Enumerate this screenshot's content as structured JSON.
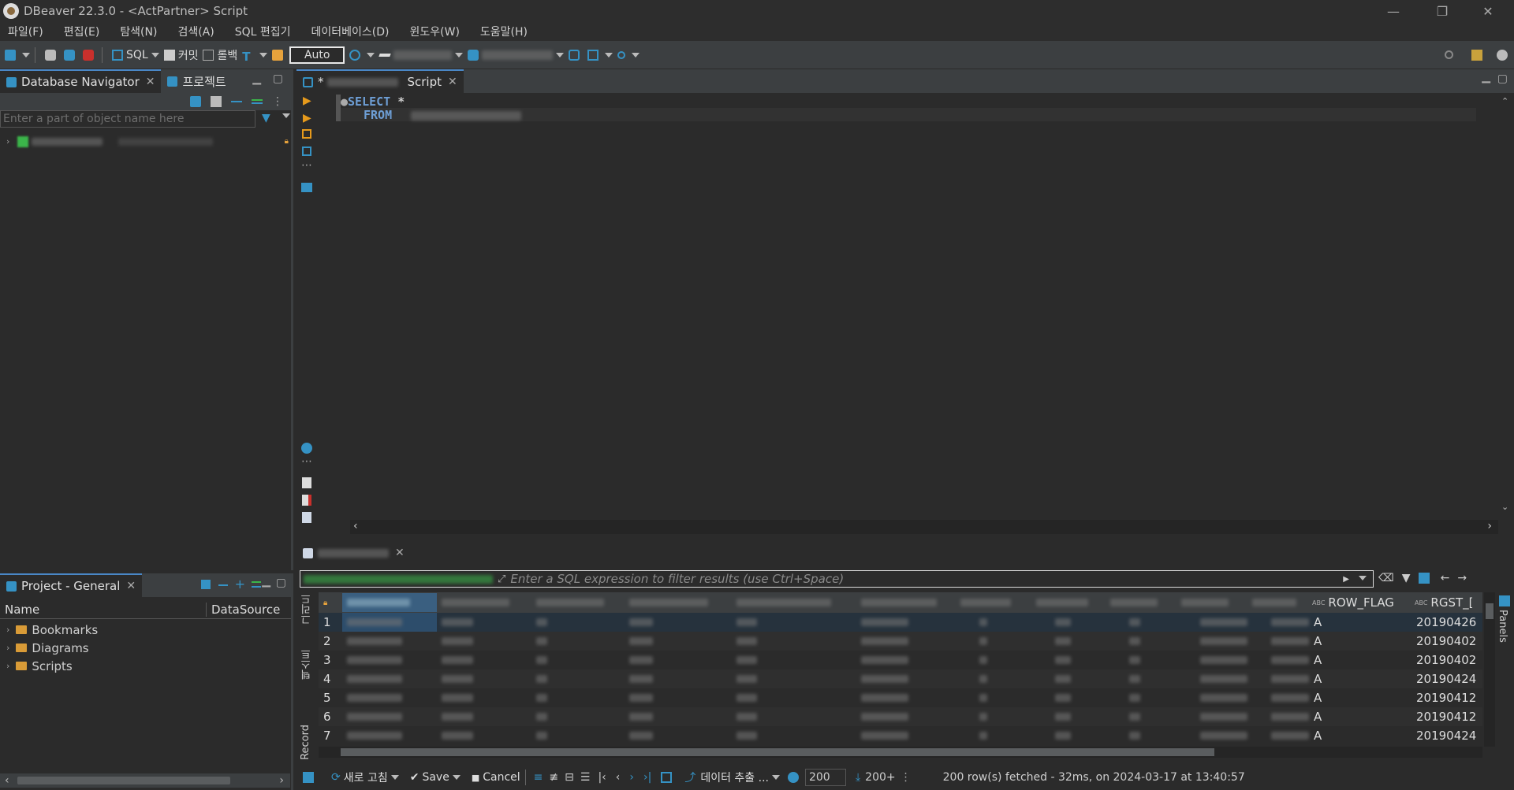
{
  "window": {
    "title": "DBeaver 22.3.0 - <ActPartner> Script",
    "controls": [
      "—",
      "❐",
      "✕"
    ]
  },
  "menu": [
    "파일(F)",
    "편집(E)",
    "탐색(N)",
    "검색(A)",
    "SQL 편집기",
    "데이터베이스(D)",
    "윈도우(W)",
    "도움말(H)"
  ],
  "toolbar": {
    "sql_label": "SQL",
    "commit_label": "커밋",
    "rollback_label": "롤백",
    "auto_label": "Auto"
  },
  "navigator": {
    "tab_label": "Database Navigator",
    "project_tab_label": "프로젝트",
    "filter_placeholder": "Enter a part of object name here"
  },
  "project_panel": {
    "tab_label": "Project - General",
    "col_name": "Name",
    "col_datasource": "DataSource",
    "items": [
      {
        "label": "Bookmarks",
        "icon": "bookmarks-folder-icon"
      },
      {
        "label": "Diagrams",
        "icon": "diagrams-folder-icon"
      },
      {
        "label": "Scripts",
        "icon": "scripts-folder-icon"
      }
    ]
  },
  "editor": {
    "tab_label": "Script",
    "tab_prefix": "*",
    "lines": [
      {
        "keyword": "SELECT",
        "rest": " *"
      },
      {
        "keyword": "FROM",
        "rest": ""
      }
    ]
  },
  "results": {
    "filter_placeholder": "Enter a SQL expression to filter results (use Ctrl+Space)",
    "side_tabs": [
      "그리드",
      "텍스트",
      "Record"
    ],
    "right_panel_label": "Panels",
    "columns_visible": [
      "ROW_FLAG",
      "RGST_["
    ],
    "rows": [
      {
        "n": "1",
        "row_flag": "A",
        "rgst": "20190426"
      },
      {
        "n": "2",
        "row_flag": "A",
        "rgst": "20190402"
      },
      {
        "n": "3",
        "row_flag": "A",
        "rgst": "20190402"
      },
      {
        "n": "4",
        "row_flag": "A",
        "rgst": "20190424"
      },
      {
        "n": "5",
        "row_flag": "A",
        "rgst": "20190412"
      },
      {
        "n": "6",
        "row_flag": "A",
        "rgst": "20190412"
      },
      {
        "n": "7",
        "row_flag": "A",
        "rgst": "20190424"
      }
    ],
    "status": {
      "refresh_label": "새로 고침",
      "save_label": "Save",
      "cancel_label": "Cancel",
      "export_label": "데이터 추출 ...",
      "fetch_size": "200",
      "fetch_more": "200+",
      "message": "200 row(s) fetched - 32ms, on 2024-03-17 at 13:40:57"
    }
  },
  "colors": {
    "accent": "#4a88c7",
    "bg": "#2b2b2b",
    "panel": "#3c3f41",
    "keyword": "#6e9fd6"
  }
}
